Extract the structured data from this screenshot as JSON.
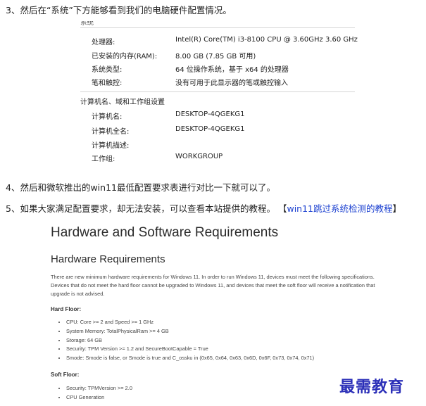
{
  "steps": {
    "s3": "3、然后在“系统”下方能够看到我们的电脑硬件配置情况。",
    "s4": "4、然后和微软推出的win11最低配置要求表进行对比一下就可以了。",
    "s5_text": "5、如果大家满足配置要求，却无法安装，可以查看本站提供的教程。",
    "s5_open": "【",
    "s5_link": "win11跳过系统检测的教程",
    "s5_close": "】"
  },
  "sysinfo": {
    "header": "系统",
    "rows": [
      {
        "label": "处理器:",
        "value": "Intel(R) Core(TM) i3-8100 CPU @ 3.60GHz   3.60 GHz"
      },
      {
        "label": "已安装的内存(RAM):",
        "value": "8.00 GB (7.85 GB 可用)"
      },
      {
        "label": "系统类型:",
        "value": "64 位操作系统，基于 x64 的处理器"
      },
      {
        "label": "笔和触控:",
        "value": "没有可用于此显示器的笔或触控输入"
      }
    ],
    "section2_title": "计算机名、域和工作组设置",
    "rows2": [
      {
        "label": "计算机名:",
        "value": "DESKTOP-4QGEKG1"
      },
      {
        "label": "计算机全名:",
        "value": "DESKTOP-4QGEKG1"
      },
      {
        "label": "计算机描述:",
        "value": ""
      },
      {
        "label": "工作组:",
        "value": "WORKGROUP"
      }
    ]
  },
  "requirements": {
    "title": "Hardware and Software Requirements",
    "subtitle": "Hardware Requirements",
    "intro": "There are new minimum hardware requirements for Windows 11. In order to run Windows 11, devices must meet the following specifications. Devices that do not meet the hard floor cannot be upgraded to Windows 11, and devices that meet the soft floor will receive a notification that upgrade is not advised.",
    "hard_floor_label": "Hard Floor:",
    "hard_floor": [
      "CPU: Core >= 2 and Speed >= 1 GHz",
      "System Memory: TotalPhysicalRam >= 4 GB",
      "Storage: 64 GB",
      "Security: TPM Version >= 1.2 and SecureBootCapable = True",
      "Smode: Smode is false, or Smode is true and C_ossku in (0x65, 0x64, 0x63, 0x6D, 0x6F, 0x73, 0x74, 0x71)"
    ],
    "soft_floor_label": "Soft Floor:",
    "soft_floor": [
      "Security: TPMVersion >= 2.0",
      "CPU Generation"
    ]
  },
  "watermark": "最需教育"
}
